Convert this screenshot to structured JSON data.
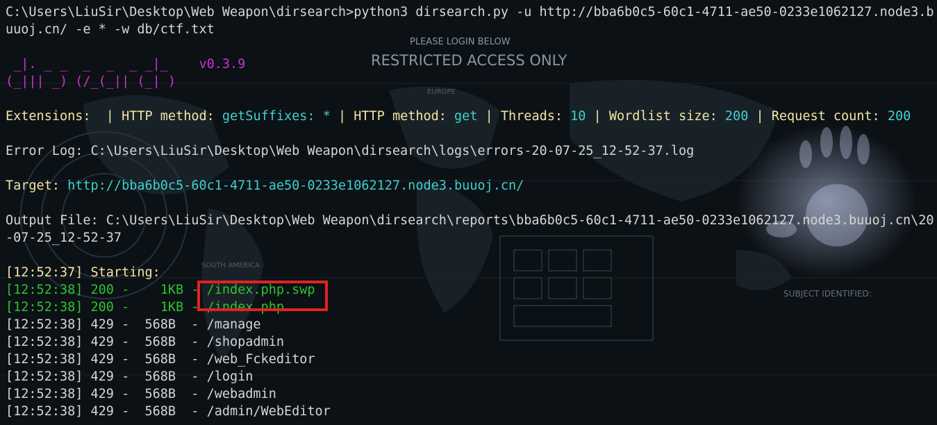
{
  "background": {
    "please_login": "PLEASE LOGIN BELOW",
    "restricted": "RESTRICTED ACCESS ONLY",
    "subject": "SUBJECT IDENTIFIED:",
    "europe": "EUROPE",
    "south_america": "SOUTH AMERICA"
  },
  "command": {
    "line1": "C:\\Users\\LiuSir\\Desktop\\Web Weapon\\dirsearch>python3 dirsearch.py -u http://bba6b0c5-60c1-4711-ae50-0233e1062127.node3.b",
    "line2": "uuoj.cn/ -e * -w db/ctf.txt"
  },
  "banner": {
    "art1": " _|. _ _  _  _  _ _|_    ",
    "version": "v0.3.9",
    "art2": "(_||| _) (/_(_|| (_| )"
  },
  "config": {
    "ext_label": "Extensions:",
    "sep": " | ",
    "http_label_1": "HTTP method: ",
    "suffix_label": "getSuffixes: ",
    "suffix_value": "*",
    "http_label_2": "HTTP method: ",
    "http_value": "get",
    "threads_label": "Threads: ",
    "threads_value": "10",
    "wordlist_label": "Wordlist size: ",
    "wordlist_value": "200",
    "request_label": "Request count: ",
    "request_value": "200"
  },
  "error_log": "Error Log: C:\\Users\\LiuSir\\Desktop\\Web Weapon\\dirsearch\\logs\\errors-20-07-25_12-52-37.log",
  "target": {
    "label": "Target: ",
    "url": "http://bba6b0c5-60c1-4711-ae50-0233e1062127.node3.buuoj.cn/"
  },
  "output": {
    "line1": "Output File: C:\\Users\\LiuSir\\Desktop\\Web Weapon\\dirsearch\\reports\\bba6b0c5-60c1-4711-ae50-0233e1062127.node3.buuoj.cn\\20",
    "line2": "-07-25_12-52-37"
  },
  "starting": "[12:52:37] Starting:",
  "results": [
    {
      "text": "[12:52:38] 200 -    1KB - /index.php.swp",
      "status": "200"
    },
    {
      "text": "[12:52:38] 200 -    1KB - /index.php",
      "status": "200"
    },
    {
      "text": "[12:52:38] 429 -  568B  - /manage",
      "status": "429"
    },
    {
      "text": "[12:52:38] 429 -  568B  - /shopadmin",
      "status": "429"
    },
    {
      "text": "[12:52:38] 429 -  568B  - /web_Fckeditor",
      "status": "429"
    },
    {
      "text": "[12:52:38] 429 -  568B  - /login",
      "status": "429"
    },
    {
      "text": "[12:52:38] 429 -  568B  - /webadmin",
      "status": "429"
    },
    {
      "text": "[12:52:38] 429 -  568B  - /admin/WebEditor",
      "status": "429"
    }
  ],
  "colors": {
    "success": "#2ec42e",
    "value": "#3fd0d0",
    "label": "#f2e7a3",
    "banner": "#cc33cc",
    "highlight": "#e22222"
  }
}
